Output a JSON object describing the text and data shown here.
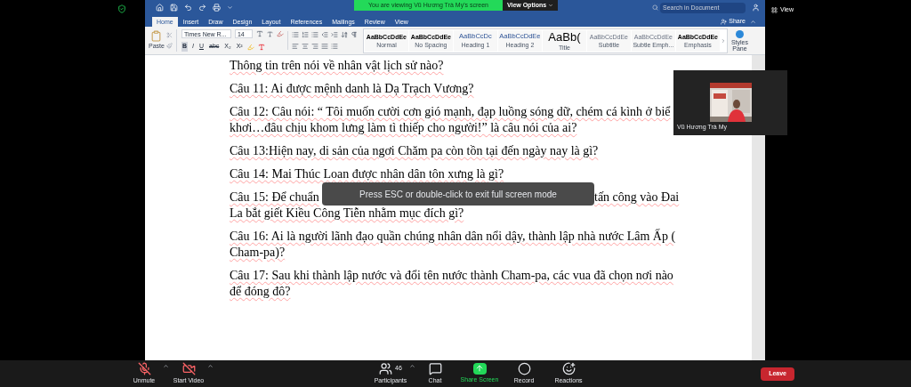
{
  "meeting": {
    "banner": "You are viewing Vũ Hương Trà My's screen",
    "view_options": "View Options",
    "view_button": "View"
  },
  "word": {
    "tabs": [
      {
        "label": "Home",
        "selected": true
      },
      {
        "label": "Insert",
        "selected": false
      },
      {
        "label": "Draw",
        "selected": false
      },
      {
        "label": "Design",
        "selected": false
      },
      {
        "label": "Layout",
        "selected": false
      },
      {
        "label": "References",
        "selected": false
      },
      {
        "label": "Mailings",
        "selected": false
      },
      {
        "label": "Review",
        "selected": false
      },
      {
        "label": "View",
        "selected": false
      }
    ],
    "share": "Share",
    "search": {
      "placeholder": "Search in Document"
    },
    "paste": "Paste",
    "font": {
      "name": "Times New R...",
      "size": "14"
    },
    "format_buttons": [
      {
        "label": "B",
        "kind": "bold"
      },
      {
        "label": "I",
        "kind": "italic"
      },
      {
        "label": "U",
        "kind": "underline"
      },
      {
        "label": "abc",
        "kind": "strike"
      },
      {
        "label": "X₂",
        "kind": "plain"
      },
      {
        "label": "X²",
        "kind": "plain"
      }
    ],
    "styles": [
      {
        "preview": "AaBbCcDdEe",
        "label": "Normal",
        "kind": "normal"
      },
      {
        "preview": "AaBbCcDdEe",
        "label": "No Spacing",
        "kind": "normal"
      },
      {
        "preview": "AaBbCcDc",
        "label": "Heading 1",
        "kind": "heading"
      },
      {
        "preview": "AaBbCcDdEe",
        "label": "Heading 2",
        "kind": "heading"
      },
      {
        "preview": "AaBb(",
        "label": "Title",
        "kind": "title"
      },
      {
        "preview": "AaBbCcDdEe",
        "label": "Subtitle",
        "kind": "subtle"
      },
      {
        "preview": "AaBbCcDdEe",
        "label": "Subtle Emph...",
        "kind": "subtle"
      },
      {
        "preview": "AaBbCcDdEe",
        "label": "Emphasis",
        "kind": "normal"
      }
    ],
    "styles_pane": [
      "Styles",
      "Pane"
    ]
  },
  "document": {
    "paragraphs": [
      {
        "lines": [
          "Thông tin trên nói về nhân vật lịch sử nào?"
        ]
      },
      {
        "lines": [
          "Câu 11: Ai được mệnh danh là Dạ Trạch Vương?"
        ]
      },
      {
        "lines": [
          "Câu 12: Câu nói: “ Tôi muốn cười cơn gió mạnh, đạp luồng sóng dữ, chém cá kình ở biể",
          "khơi…đâu chịu khom lưng làm tì thiếp cho người!” là câu nói của ai?"
        ]
      },
      {
        "lines": [
          "Câu 13:Hiện nay, di sản của ngơi Chăm pa còn tồn tại đến ngày nay là gì?"
        ]
      },
      {
        "lines": [
          "Câu 14: Mai Thúc Loan được nhân dân tôn xưng là gì?"
        ]
      },
      {
        "lines": [
          "Câu 15: Để chuẩn",
          "La bắt giết Kiều Công Tiễn nhằm mục đích gì?"
        ],
        "after_toast": "tấn công vào Đai"
      },
      {
        "lines": [
          "Câu 16: Ai là người lãnh đạo quần chúng nhân dân nổi dậy, thành lập nhà nước Lâm Ấp (",
          "Cham-pa)?"
        ]
      },
      {
        "lines": [
          "Câu 17: Sau khi thành lập nước và đổi tên nước thành Cham-pa, các vua đã chọn nơi nào",
          "để đóng đô?"
        ]
      }
    ]
  },
  "toast": "Press ESC or double-click to exit full screen mode",
  "video_tile": {
    "name": "Vũ Hương Trà My"
  },
  "toolbar": {
    "items": [
      {
        "label": "Unmute",
        "kind": "mic",
        "caret": true
      },
      {
        "label": "Start Video",
        "kind": "video",
        "caret": true
      },
      {
        "label": "Participants",
        "kind": "participants",
        "count": "46",
        "caret": true
      },
      {
        "label": "Chat",
        "kind": "chat",
        "caret": false
      },
      {
        "label": "Share Screen",
        "kind": "share",
        "caret": false
      },
      {
        "label": "Record",
        "kind": "record",
        "caret": false
      },
      {
        "label": "Reactions",
        "kind": "reactions",
        "caret": false
      }
    ],
    "leave": "Leave"
  }
}
